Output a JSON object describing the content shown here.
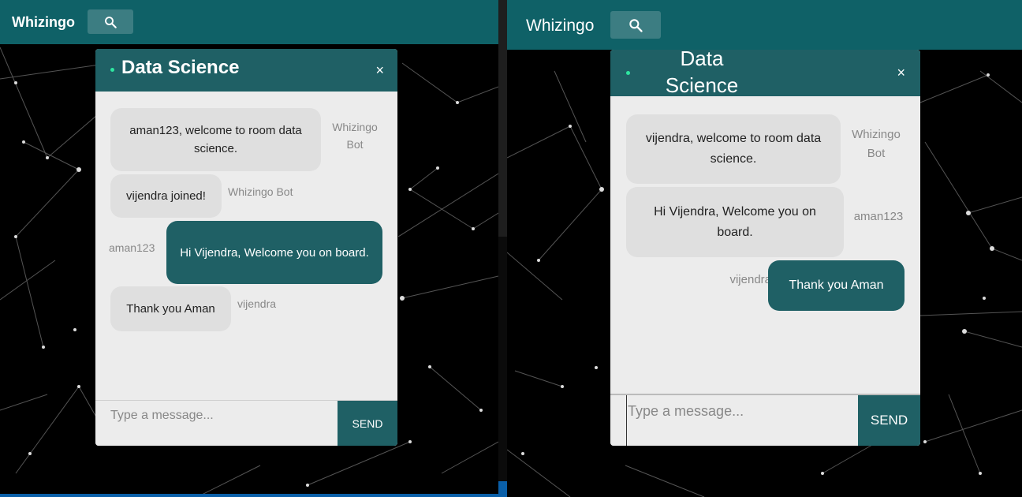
{
  "left": {
    "app_name": "Whizingo",
    "search_icon": "search-icon",
    "room_title": "Data Science",
    "close_label": "×",
    "messages": [
      {
        "text": "aman123, welcome to room data science.",
        "sender": "Whizingo Bot",
        "direction": "incoming"
      },
      {
        "text": "vijendra joined!",
        "sender": "Whizingo Bot",
        "direction": "incoming"
      },
      {
        "text": "Hi Vijendra, Welcome you on board.",
        "sender": "aman123",
        "direction": "outgoing"
      },
      {
        "text": "Thank you Aman",
        "sender": "vijendra",
        "direction": "incoming"
      }
    ],
    "input_placeholder": "Type a message...",
    "send_label": "SEND"
  },
  "right": {
    "app_name": "Whizingo",
    "search_icon": "search-icon",
    "room_title": "Data Science",
    "close_label": "×",
    "messages": [
      {
        "text": "vijendra, welcome to room data science.",
        "sender": "Whizingo Bot",
        "direction": "incoming"
      },
      {
        "text": "Hi Vijendra, Welcome you on board.",
        "sender": "aman123",
        "direction": "incoming"
      },
      {
        "text": "Thank you Aman",
        "sender": "vijendra",
        "direction": "outgoing"
      }
    ],
    "input_placeholder": "Type a message...",
    "send_label": "SEND"
  },
  "colors": {
    "topbar": "#0f6167",
    "chat_header": "#1f6065",
    "online": "#2ee6a0",
    "bubble_in": "#dfdfdf",
    "bubble_out": "#1f6065"
  }
}
